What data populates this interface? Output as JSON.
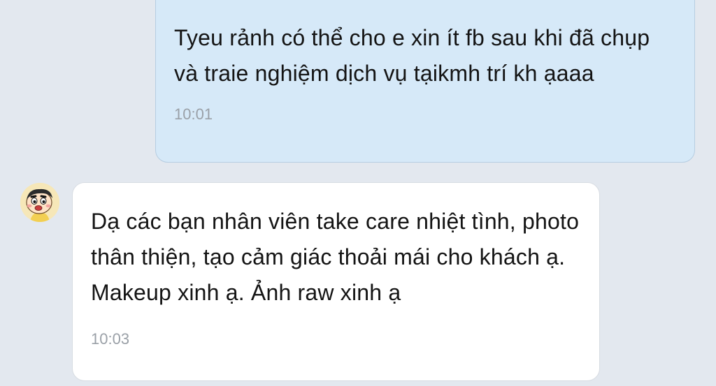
{
  "messages": [
    {
      "direction": "outgoing",
      "text": "Tyeu rảnh có thể cho e xin ít fb sau khi đã chụp và traie nghiệm dịch vụ tạikmh trí kh ạaaa",
      "time": "10:01"
    },
    {
      "direction": "incoming",
      "text": "Dạ các bạn nhân viên take care nhiệt tình, photo thân thiện, tạo cảm giác thoải mái cho khách ạ. Makeup xinh ạ. Ảnh raw xinh ạ",
      "time": "10:03",
      "avatar_icon": "cartoon-boy-avatar-icon"
    }
  ],
  "colors": {
    "background": "#e3e8ef",
    "outgoing_bubble": "#d6e9f8",
    "incoming_bubble": "#ffffff",
    "timestamp": "#9aa0a7"
  }
}
